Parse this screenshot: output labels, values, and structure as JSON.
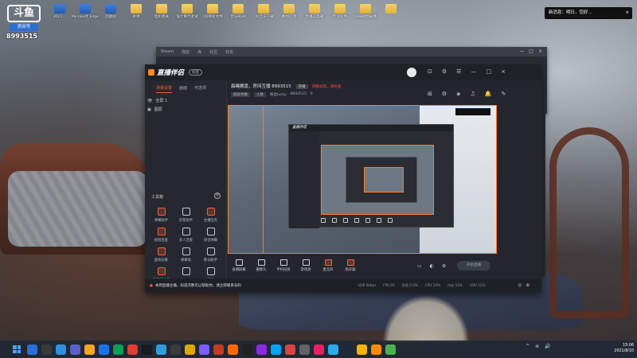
{
  "desktop": {
    "logo": {
      "mark": "斗鱼",
      "sub": "房间号",
      "room_number": "8993515"
    },
    "icons": [
      {
        "label": "2021...",
        "type": "app"
      },
      {
        "label": "Microsoft Edge",
        "type": "app"
      },
      {
        "label": "回收站",
        "type": "app"
      },
      {
        "label": "杂项",
        "type": "folder"
      },
      {
        "label": "电机相关",
        "type": "folder"
      },
      {
        "label": "设计算代考试",
        "type": "folder"
      },
      {
        "label": "QQ接收文件",
        "type": "folder"
      },
      {
        "label": "音乐BGM",
        "type": "folder"
      },
      {
        "label": "QQ音乐下载",
        "type": "folder"
      },
      {
        "label": "素材应用",
        "type": "folder"
      },
      {
        "label": "直播工具箱",
        "type": "folder"
      },
      {
        "label": "专业软件",
        "type": "folder"
      },
      {
        "label": "OBS视频录像",
        "type": "folder"
      },
      {
        "label": "",
        "type": "folder"
      }
    ]
  },
  "notification": {
    "text": "新消息：明日，您好...",
    "close": "×"
  },
  "bg_window": {
    "tabs": [
      "Steam",
      "商店",
      "库",
      "社区",
      "好友"
    ],
    "win_controls": [
      "—",
      "□",
      "×"
    ]
  },
  "app": {
    "name": "直播伴侣",
    "version": "抖音",
    "title_icons": [
      "⊡",
      "⚙",
      "☰",
      "—",
      "□",
      "×"
    ],
    "left_tabs": [
      "场景设置",
      "画面",
      "可选项"
    ],
    "scenes": [
      {
        "label": "全屏 1",
        "icon": "👁"
      },
      {
        "label": "图层",
        "icon": "▣"
      }
    ],
    "tools_header": "工具箱",
    "tools_plus": "+",
    "tools": [
      {
        "label": "弹幕助手",
        "red": true
      },
      {
        "label": "房管助手",
        "red": false
      },
      {
        "label": "主播任务",
        "red": true
      },
      {
        "label": "视频连麦",
        "red": true
      },
      {
        "label": "多人连麦",
        "red": false
      },
      {
        "label": "语音弹幕",
        "red": false
      },
      {
        "label": "虚拟形象",
        "red": true
      },
      {
        "label": "弹幕墙",
        "red": false
      },
      {
        "label": "歌词助手",
        "red": false
      },
      {
        "label": "直播间分享",
        "red": true
      },
      {
        "label": "",
        "red": false
      },
      {
        "label": "更多",
        "red": false
      }
    ],
    "room": {
      "title": "晨曦搬盘，房间互播 8993515",
      "tag": "开播",
      "warning": "网络异常，请检查",
      "chips": [
        "超级弹幕",
        "人数",
        "粉丝lucky",
        "8993515",
        "0"
      ]
    },
    "room_icons": [
      "⊞",
      "⚙",
      "◈",
      "♫",
      "🔔",
      "✎"
    ],
    "nested_app_name": "直播伴侣",
    "controls": [
      {
        "label": "直播屏幕",
        "red": false
      },
      {
        "label": "摄像头",
        "red": false
      },
      {
        "label": "手机投屏",
        "red": false
      },
      {
        "label": "游戏源",
        "red": false
      },
      {
        "label": "麦克风",
        "red": true
      },
      {
        "label": "扬声器",
        "red": true
      }
    ],
    "extra_controls": [
      "▭",
      "◐",
      "⚙"
    ],
    "start_live": "开始直播",
    "notice": "本周直播主播，知道次数可以帮助你，请立即联系号码",
    "stats": [
      "码率 0kbps",
      "FPS 60",
      "丢帧 0.0%",
      "CPU 24%",
      "内存 52%",
      "GPU 12%"
    ],
    "status_ctl": [
      "◎",
      "⊕"
    ]
  },
  "side_panel": {
    "rows": [
      "",
      "直播入",
      "直播入",
      "直播入",
      "直播入",
      "直播入",
      "直播入"
    ],
    "redtag": "新"
  },
  "taskbar": {
    "icons": [
      "#2c6fd6",
      "#3a3a3a",
      "#2f8fdf",
      "#5b5fc7",
      "#f5a623",
      "#1a73e8",
      "#0f9d58",
      "#e03c31",
      "#171a21",
      "#2d9cdb",
      "#3b3b3b",
      "#e0a800",
      "#7a5cff",
      "#c23b22",
      "#ff6a00",
      "#222222",
      "#8a2be2",
      "#00a4ef",
      "#d64541",
      "#5f6368",
      "#e91e63",
      "#2aabee",
      "#1b2838",
      "#f4b400",
      "#ff8c00",
      "#4caf50"
    ],
    "tray": [
      "^",
      "≋",
      "🔊"
    ],
    "time": "15:06",
    "date": "2021/8/10"
  }
}
